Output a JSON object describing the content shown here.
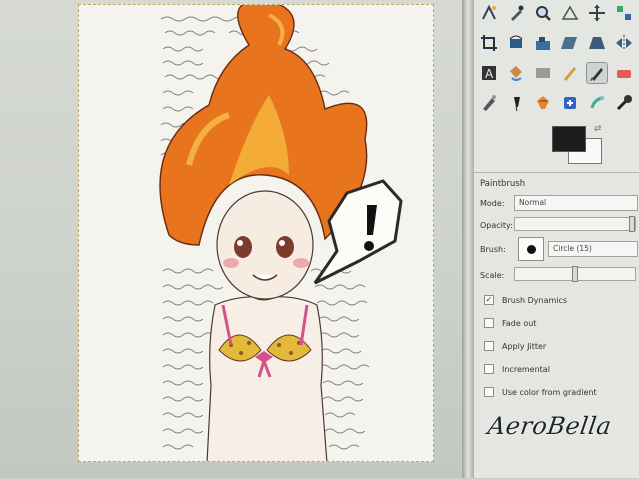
{
  "tool_options": {
    "title": "Paintbrush",
    "mode_label": "Mode:",
    "mode_value": "Normal",
    "opacity_label": "Opacity:",
    "opacity_value": 1.0,
    "brush_label": "Brush:",
    "brush_value": "Circle (15)",
    "scale_label": "Scale:",
    "scale_value": 0.5,
    "checkboxes": [
      {
        "label": "Brush Dynamics",
        "checked": true
      },
      {
        "label": "Fade out",
        "checked": false
      },
      {
        "label": "Apply Jitter",
        "checked": false
      },
      {
        "label": "Incremental",
        "checked": false
      },
      {
        "label": "Use color from gradient",
        "checked": false
      }
    ]
  },
  "colors": {
    "foreground": "#1c1d1f",
    "background": "#fafafa",
    "canvas_accent_hair": "#e8741e",
    "canvas_accent_bikini": "#e3b93a"
  },
  "tools": [
    "fuzzy-select-icon",
    "color-picker-icon",
    "zoom-icon",
    "measure-icon",
    "move-icon",
    "align-icon",
    "crop-icon",
    "rotate-icon",
    "scale-icon",
    "shear-icon",
    "perspective-icon",
    "flip-icon",
    "text-icon",
    "bucket-fill-icon",
    "blend-icon",
    "pencil-icon",
    "paintbrush-icon",
    "eraser-icon",
    "airbrush-icon",
    "ink-icon",
    "clone-icon",
    "heal-icon",
    "smudge-icon",
    "dodge-icon"
  ],
  "watermark": "AeroBella"
}
